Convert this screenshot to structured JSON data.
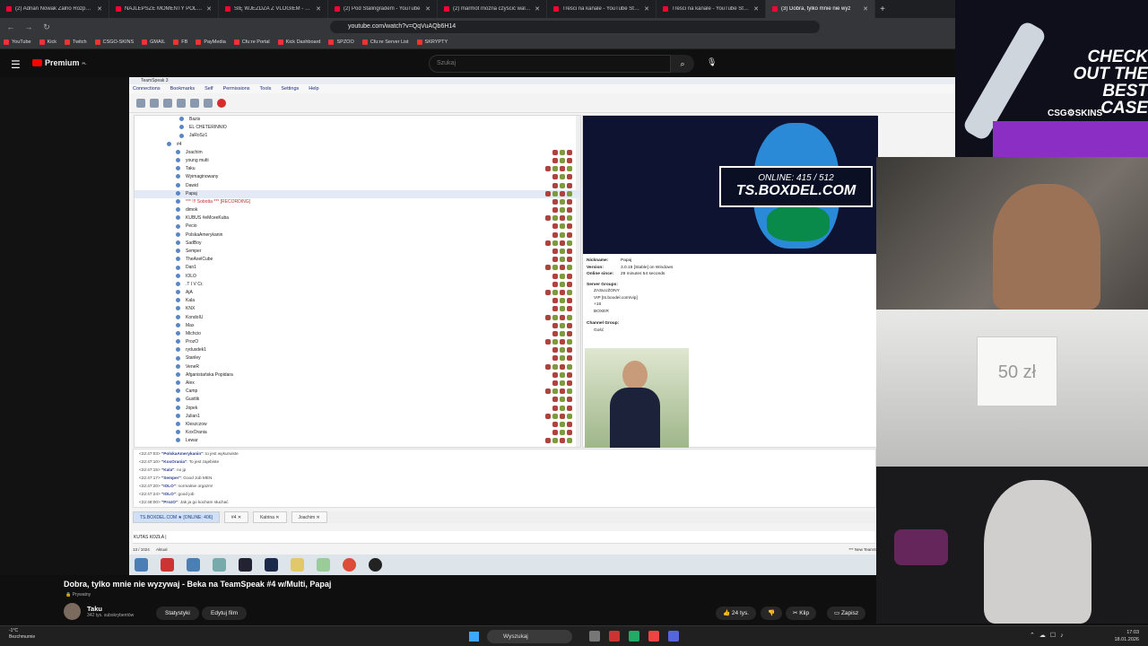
{
  "browser": {
    "tabs": [
      {
        "title": "(2) Adrian Nowak Żalno Rozpakowa"
      },
      {
        "title": "NAJLEPSZE MOMENTY POLSKIEGO T"
      },
      {
        "title": "SIĘ WJEŻDŻA Z VLOGIEM - YouTube"
      },
      {
        "title": "(2) Pod Stalingradem - YouTube"
      },
      {
        "title": "(2) marmot można czyścić walkiem"
      },
      {
        "title": "Treści na kanale - YouTube Studio"
      },
      {
        "title": "Treści na kanale - YouTube Studio"
      },
      {
        "title": "(3) Dobra, tylko mnie nie wyz"
      }
    ],
    "url": "youtube.com/watch?v=QqVuAQb6H14",
    "bookmarks": [
      "YouTube",
      "Kick",
      "Twitch",
      "CSGO-SKINS",
      "GMAIL",
      "FB",
      "PayMedia",
      "Cfu:re Portal",
      "Kick Dashboard",
      "SPZOO",
      "Cfu:re Server List",
      "SKRYPTY"
    ]
  },
  "youtube": {
    "logo": "Premium",
    "logo_region": "PL",
    "search_placeholder": "Szukaj"
  },
  "teamspeak": {
    "title": "TeamSpeak 3",
    "menu": [
      "Connections",
      "Bookmarks",
      "Self",
      "Permissions",
      "Tools",
      "Settings",
      "Help"
    ],
    "tree": [
      "Bazis",
      "EL CHETERINNIO",
      "JaRoSz1",
      "#4",
      "Joachim",
      "young multi",
      "Taku",
      "Wyimaginowany",
      "Dawid",
      "Papaj",
      "*** !!! Sobotta *** [RECORDING]",
      "dimok",
      "KUBUS #eMceeKuba",
      "Pecio",
      "PolskaAmerykanin",
      "SadBoy",
      "Semper",
      "TheAxelCube",
      "Dan1",
      "IOLO",
      ".T I V Cr.",
      "AjA",
      "Kala",
      "KNX",
      "KondoIU",
      "Max",
      "Michcio",
      "ProzO",
      "rydusdek1",
      "Stanley",
      "VeneR",
      "Afganistańska Popidara",
      "Alex",
      "Camp",
      "Gustlik",
      "Jopek",
      "Julian1",
      "Kleszczow",
      "KoxOrania",
      "Lewar"
    ],
    "selected": "Papaj",
    "banner": {
      "online_label": "ONLINE: 415 / 512",
      "domain": "TS.BOXDEL.COM"
    },
    "client": {
      "nickname_label": "Nickname:",
      "nickname": "Papaj",
      "version_label": "Version:",
      "version": "3.0.19 [Stable] on Windows",
      "online_label": "Online since:",
      "online": "29 minutes 54 seconds",
      "server_groups_label": "Server Groups:",
      "server_groups": [
        "ZASŁUŻONY",
        "VIP [ts.boxdel.com/vip]",
        "+16",
        "BOXER"
      ],
      "channel_group_label": "Channel Group:",
      "channel_group": "Gość"
    },
    "chat": [
      {
        "time": "<22:47:03>",
        "name": "\"PolskaAmerykanin\"",
        "msg": ": to jest wykurwiste"
      },
      {
        "time": "<22:47:10>",
        "name": "\"KoxOrania\"",
        "msg": ": To jest zajebiste"
      },
      {
        "time": "<22:47:15>",
        "name": "\"Kala\"",
        "msg": ": no jp"
      },
      {
        "time": "<22:47:17>",
        "name": "\"Semper\"",
        "msg": ": Good Job MEN"
      },
      {
        "time": "<22:47:20>",
        "name": "\"IOLO\"",
        "msg": ": normalnie orgazm!"
      },
      {
        "time": "<22:47:24>",
        "name": "\"IOLO\"",
        "msg": ": good job"
      },
      {
        "time": "<22:48:00>",
        "name": "\"ProzO\"",
        "msg": ": Jak ja go kocham słuchać"
      }
    ],
    "chat_tabs": [
      "TS.BOXDEL.COM ★ [ONLINE: 406]",
      "#4",
      "Katrina",
      "Joachim"
    ],
    "chat_input": "KUTAS KOZŁA |",
    "status_left": "13 / 1024",
    "status_mid": "Aktual",
    "status_right": "*** New TeamS"
  },
  "ad": {
    "headline": "CHECK OUT THE BEST CASE",
    "brand": "CSG⚙SKINS"
  },
  "cam": {
    "sign": "50 zł"
  },
  "video": {
    "title": "Dobra, tylko mnie nie wyzywaj - Beka na TeamSpeak #4 w/Multi, Papaj",
    "privacy": "Prywatny",
    "channel": "Taku",
    "subscribers": "342 tys. subskrybentów",
    "stats_button": "Statystyki",
    "edit_button": "Edytuj film",
    "likes": "24 tys.",
    "clip_button": "Klip",
    "save_button": "Zapisz"
  },
  "taskbar": {
    "weather_temp": "-1°C",
    "weather_desc": "Bezchmurnie",
    "search": "Wyszukaj",
    "time": "17:03",
    "date": "18.01.2026"
  }
}
